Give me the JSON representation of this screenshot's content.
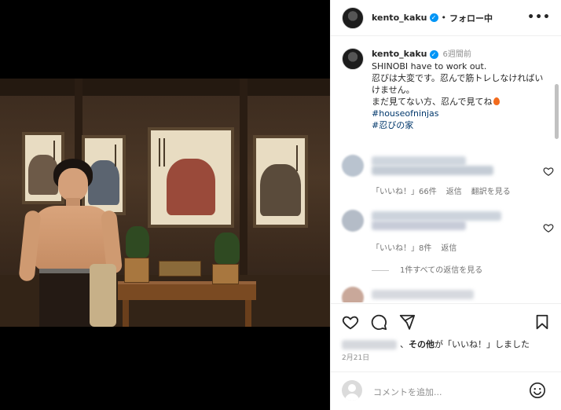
{
  "post": {
    "username": "kento_kaku",
    "follow_status": "フォロー中",
    "more_label": "•••"
  },
  "caption": {
    "username": "kento_kaku",
    "time_ago": "6週間前",
    "line1": "SHINOBI have to work out.",
    "line2": "忍びは大変です。忍んで筋トレしなければいけません。",
    "line3": "まだ見てない方、忍んで見てね",
    "hashtag1": "#houseofninjas",
    "hashtag2": "#忍びの家"
  },
  "comments": [
    {
      "likes_label": "「いいね！」66件",
      "reply_label": "返信",
      "translate_label": "翻訳を見る"
    },
    {
      "likes_label": "「いいね！」8件",
      "reply_label": "返信"
    }
  ],
  "view_replies_label": "1件すべての返信を見る",
  "likes_summary": {
    "suffix": "、その他が「いいね！」しました",
    "emphasis": "その他"
  },
  "date": "2月21日",
  "comment_input": {
    "placeholder": "コメントを追加..."
  },
  "colors": {
    "verified": "#0095f6",
    "hashtag": "#00376b",
    "secondary_text": "#8e8e8e"
  }
}
